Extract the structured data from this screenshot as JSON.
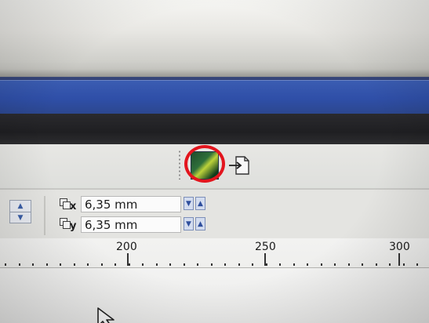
{
  "property_bar": {
    "x_label_subscript": "x",
    "y_label_subscript": "y",
    "x_value": "6,35 mm",
    "y_value": "6,35 mm"
  },
  "toolbar": {
    "icons": [
      "bitmap-thumbnail-icon",
      "export-to-page-icon"
    ],
    "highlight_color": "#e3151d"
  },
  "ruler": {
    "labels": [
      "200",
      "250",
      "300"
    ]
  },
  "colors": {
    "titlebar": "#2f4fa8",
    "panel": "#e4e4e1",
    "spin_button": "#d3dcef"
  }
}
